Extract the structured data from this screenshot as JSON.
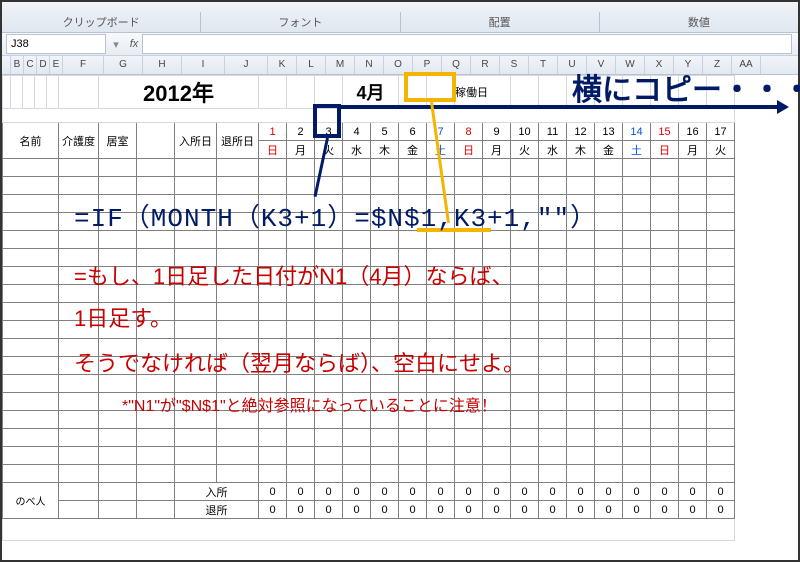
{
  "ribbon": {
    "clipboard": "クリップボード",
    "font": "フォント",
    "align": "配置",
    "number": "数値"
  },
  "namebox": "J38",
  "cols": [
    "",
    "B",
    "C",
    "D",
    "E",
    "F",
    "G",
    "H",
    "I",
    "J",
    "K",
    "L",
    "M",
    "N",
    "O",
    "P",
    "Q",
    "R",
    "S",
    "T",
    "U",
    "V",
    "W",
    "X",
    "Y",
    "Z",
    "AA"
  ],
  "row1": {
    "yearlabel": "2012年",
    "month": "4月",
    "kadou": "稼働日"
  },
  "hdr": {
    "name": "名前",
    "care": "介護度",
    "unit": "居室",
    "in": "入所日",
    "out": "退所日"
  },
  "days": [
    "1",
    "2",
    "3",
    "4",
    "5",
    "6",
    "7",
    "8",
    "9",
    "10",
    "11",
    "12",
    "13",
    "14",
    "15",
    "16",
    "17"
  ],
  "wdays": [
    "日",
    "月",
    "火",
    "水",
    "木",
    "金",
    "土",
    "日",
    "月",
    "火",
    "水",
    "木",
    "金",
    "土",
    "日",
    "月",
    "火"
  ],
  "nobe": "のべ人",
  "nyu": "入所",
  "tai": "退所",
  "zeros": [
    "0",
    "0",
    "0",
    "0",
    "0",
    "0",
    "0",
    "0",
    "0",
    "0",
    "0",
    "0",
    "0",
    "0",
    "0",
    "0",
    "0"
  ],
  "overlay": {
    "copy": "横にコピー・・・",
    "formula": "=IF（MONTH（K3+1）=$N$1,K3+1,\"\"）",
    "line1": "=もし、1日足した日付がN1（4月）ならば、",
    "line2": "1日足す。",
    "line3": "そうでなければ（翌月ならば）、空白にせよ。",
    "note": "*\"N1\"が\"$N$1\"と絶対参照になっていることに注意！"
  }
}
